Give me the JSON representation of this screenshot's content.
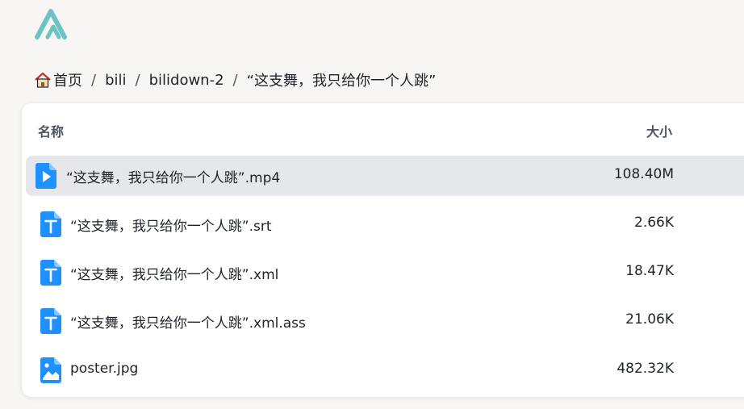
{
  "breadcrumb": {
    "home_label": "首页",
    "separator": "/",
    "items": [
      "bili",
      "bilidown-2",
      "“这支舞，我只给你一个人跳”"
    ]
  },
  "table": {
    "col_name": "名称",
    "col_size": "大小",
    "rows": [
      {
        "name": "“这支舞，我只给你一个人跳”.mp4",
        "size": "108.40M",
        "icon": "video-file-icon",
        "selected": true
      },
      {
        "name": "“这支舞，我只给你一个人跳”.srt",
        "size": "2.66K",
        "icon": "text-file-icon",
        "selected": false
      },
      {
        "name": "“这支舞，我只给你一个人跳”.xml",
        "size": "18.47K",
        "icon": "text-file-icon",
        "selected": false
      },
      {
        "name": "“这支舞，我只给你一个人跳”.xml.ass",
        "size": "21.06K",
        "icon": "text-file-icon",
        "selected": false
      },
      {
        "name": "poster.jpg",
        "size": "482.32K",
        "icon": "image-file-icon",
        "selected": false
      }
    ]
  },
  "colors": {
    "accent": "#1e90ff",
    "logo": "#6cc3c3",
    "selected_row": "#e6e7ea"
  }
}
